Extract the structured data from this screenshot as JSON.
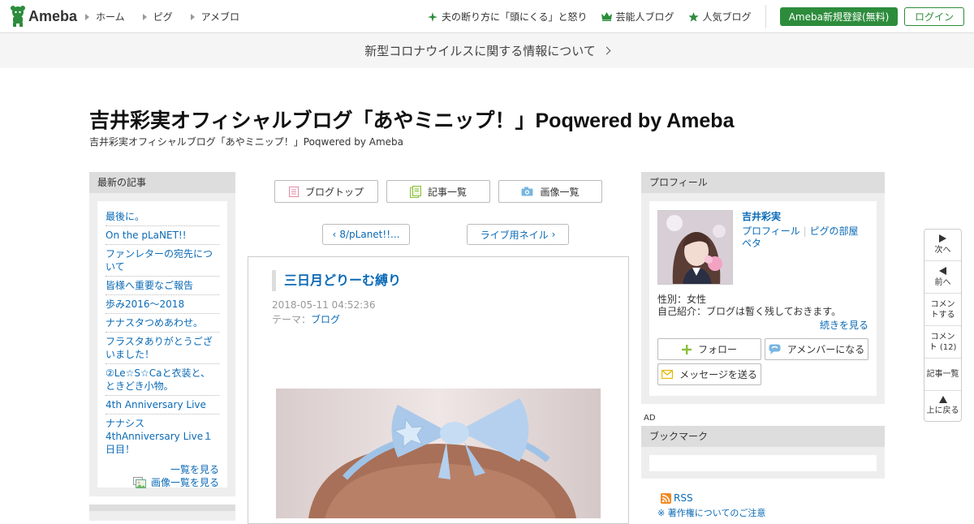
{
  "header": {
    "logo_text": "Ameba",
    "nav_left": [
      "ホーム",
      "ピグ",
      "アメブロ"
    ],
    "nav_right": [
      {
        "label": "夫の断り方に「頭にくる」と怒り",
        "icon": "sparkle-icon"
      },
      {
        "label": "芸能人ブログ",
        "icon": "crown-icon"
      },
      {
        "label": "人気ブログ",
        "icon": "star-icon"
      }
    ],
    "register_label": "Ameba新規登録(無料)",
    "login_label": "ログイン"
  },
  "notice": {
    "text": "新型コロナウイルスに関する情報について"
  },
  "blog": {
    "title": "吉井彩実オフィシャルブログ「あやミニップ！」Poqwered by Ameba",
    "subtitle": "吉井彩実オフィシャルブログ「あやミニップ！」Poqwered by Ameba"
  },
  "left_panel": {
    "heading": "最新の記事",
    "entries": [
      "最後に。",
      "On the pLaNET!!",
      "ファンレターの宛先について",
      "皆様へ重要なご報告",
      "歩み2016〜2018",
      "ナナスタつめあわせ。",
      "フラスタありがとうございました！",
      "②Le☆S☆Caと衣装と、ときどき小物。",
      "4th Anniversary Live",
      "ナナシス 4thAnniversary Live１日目！"
    ],
    "more_label": "一覧を見る",
    "images_label": "画像一覧を見る"
  },
  "center": {
    "buttons": [
      "ブログトップ",
      "記事一覧",
      "画像一覧"
    ],
    "prev_label": "8/pLanet!!...",
    "next_label": "ライブ用ネイル",
    "article": {
      "title": "三日月どりーむ縛り",
      "date": "2018-05-11 04:52:36",
      "theme_prefix": "テーマ：",
      "theme": "ブログ"
    }
  },
  "profile": {
    "heading": "プロフィール",
    "name": "吉井彩実",
    "link_profile": "プロフィール",
    "link_pig": "ピグの部屋",
    "link_peta": "ペタ",
    "gender": "性別：女性",
    "intro": "自己紹介：ブログは暫く残しておきます。",
    "read_more": "続きを見る",
    "follow_label": "フォロー",
    "amember_label": "アメンバーになる",
    "message_label": "メッセージを送る"
  },
  "ad_label": "AD",
  "bookmark": {
    "heading": "ブックマーク"
  },
  "rss": {
    "label": "RSS",
    "note": "※ 著作権についてのご注意"
  },
  "side_nav": [
    {
      "label": "次へ",
      "icon": "arrow-right-icon"
    },
    {
      "label": "前へ",
      "icon": "arrow-left-icon"
    },
    {
      "label": "コメントする",
      "icon": ""
    },
    {
      "label": "コメント (12)",
      "icon": ""
    },
    {
      "label": "記事一覧",
      "icon": ""
    },
    {
      "label": "上に戻る",
      "icon": "arrow-up-icon"
    }
  ],
  "colors": {
    "brand_green": "#2d8c3c",
    "link_blue": "#0a6ab6",
    "panel_gray": "#eeeeee"
  }
}
